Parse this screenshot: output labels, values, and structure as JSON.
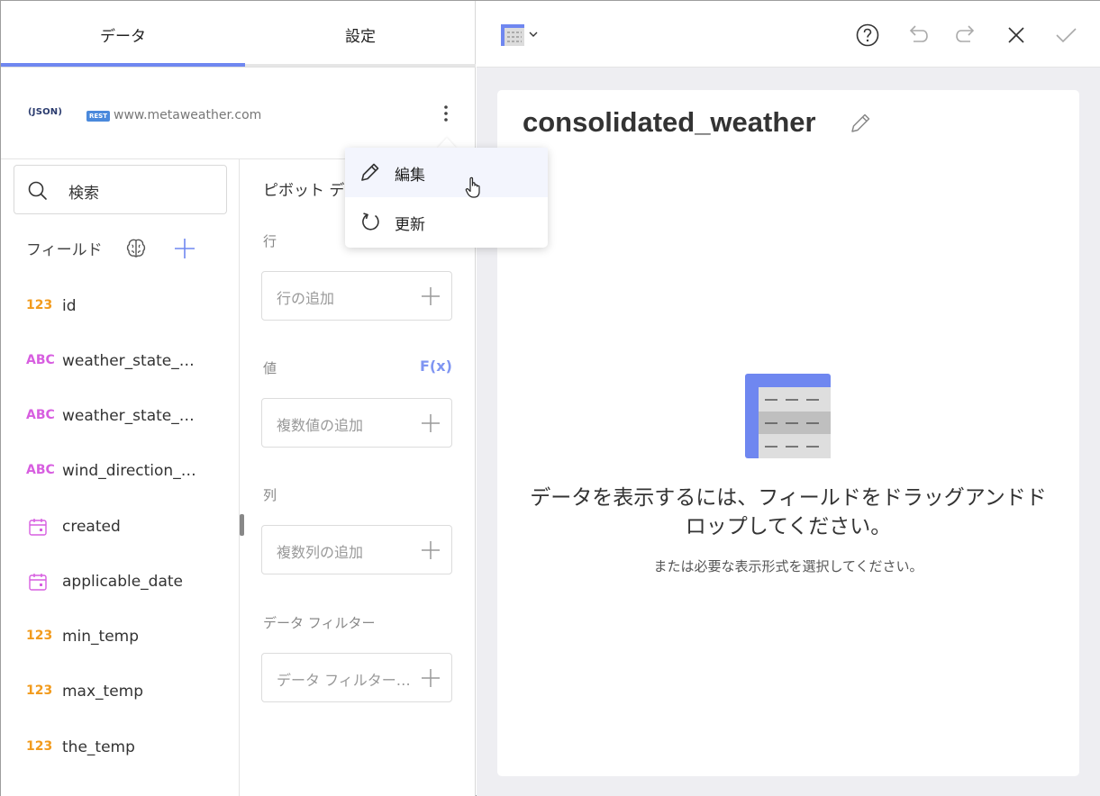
{
  "tabs": [
    {
      "label": "データ",
      "active": true
    },
    {
      "label": "設定",
      "active": false
    }
  ],
  "source": {
    "logo": "JSON",
    "badge": "REST",
    "url": "www.metaweather.com"
  },
  "search": {
    "label": "検索"
  },
  "fields_panel": {
    "header": "フィールド",
    "items": [
      {
        "type": "123",
        "kind": "number",
        "name": "id"
      },
      {
        "type": "ABC",
        "kind": "text",
        "name": "weather_state_name"
      },
      {
        "type": "ABC",
        "kind": "text",
        "name": "weather_state_abbr"
      },
      {
        "type": "ABC",
        "kind": "text",
        "name": "wind_direction_compass"
      },
      {
        "type": "",
        "kind": "date",
        "name": "created"
      },
      {
        "type": "",
        "kind": "date",
        "name": "applicable_date"
      },
      {
        "type": "123",
        "kind": "number",
        "name": "min_temp"
      },
      {
        "type": "123",
        "kind": "number",
        "name": "max_temp"
      },
      {
        "type": "123",
        "kind": "number",
        "name": "the_temp"
      }
    ]
  },
  "pivot": {
    "title": "ピボット データ",
    "rows_label": "行",
    "rows_placeholder": "行の追加",
    "values_label": "値",
    "fx_label": "F(x)",
    "values_placeholder": "複数値の追加",
    "columns_label": "列",
    "columns_placeholder": "複数列の追加",
    "filter_label": "データ フィルター",
    "filter_placeholder": "データ フィルターの追加"
  },
  "menu": {
    "items": [
      {
        "label": "編集",
        "icon": "pencil-icon"
      },
      {
        "label": "更新",
        "icon": "refresh-icon"
      }
    ]
  },
  "toolbar": {
    "icons": [
      "table-viz-icon",
      "help-icon",
      "undo-icon",
      "redo-icon",
      "close-icon",
      "check-icon"
    ]
  },
  "card": {
    "title": "consolidated_weather",
    "empty_message": "データを表示するには、フィールドをドラッグアンドドロップしてください。",
    "empty_sub": "または必要な表示形式を選択してください。"
  },
  "colors": {
    "accent": "#6f87f0",
    "number_type": "#f29b1d",
    "text_type": "#d75ee0",
    "background": "#eeeef2"
  }
}
